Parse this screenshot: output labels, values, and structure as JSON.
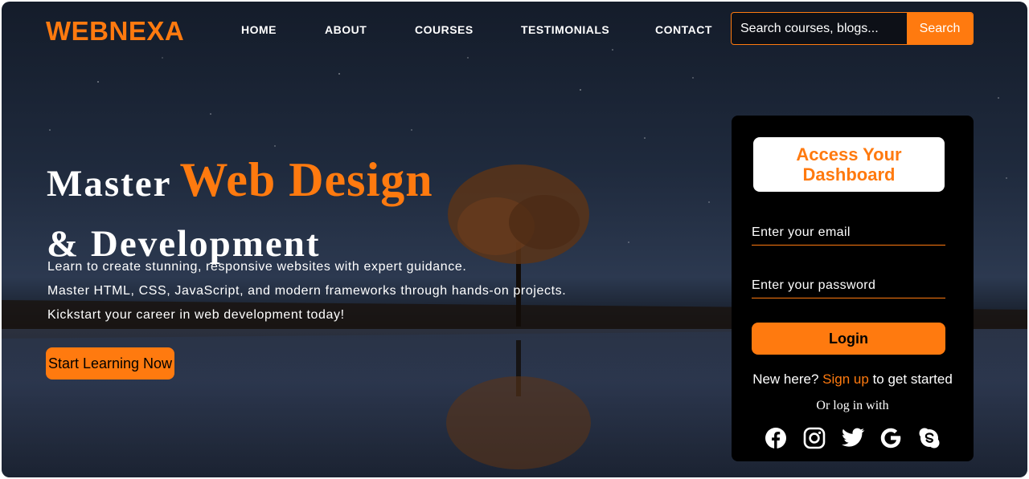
{
  "brand": {
    "logo": "WEBNEXA",
    "accent_color": "#ff7a0f"
  },
  "nav": {
    "items": [
      {
        "label": "HOME"
      },
      {
        "label": "ABOUT"
      },
      {
        "label": "COURSES"
      },
      {
        "label": "TESTIMONIALS"
      },
      {
        "label": "CONTACT"
      }
    ]
  },
  "search": {
    "placeholder": "Search courses, blogs...",
    "button_label": "Search"
  },
  "hero": {
    "title_part1": "Master",
    "title_accent": "Web Design",
    "title_part2": "& Development",
    "lines": [
      "Learn to create stunning, responsive websites with expert guidance.",
      "Master HTML, CSS, JavaScript, and modern frameworks through hands-on projects.",
      "Kickstart your career in web development today!"
    ],
    "cta_label": "Start Learning Now"
  },
  "login": {
    "title": "Access Your Dashboard",
    "email_placeholder": "Enter your email",
    "password_placeholder": "Enter your password",
    "button_label": "Login",
    "signup_prefix": "New here?",
    "signup_link": "Sign up",
    "signup_suffix": "to get started",
    "alt_text": "Or log in with",
    "socials": [
      "facebook-icon",
      "instagram-icon",
      "twitter-icon",
      "google-icon",
      "skype-icon"
    ]
  }
}
